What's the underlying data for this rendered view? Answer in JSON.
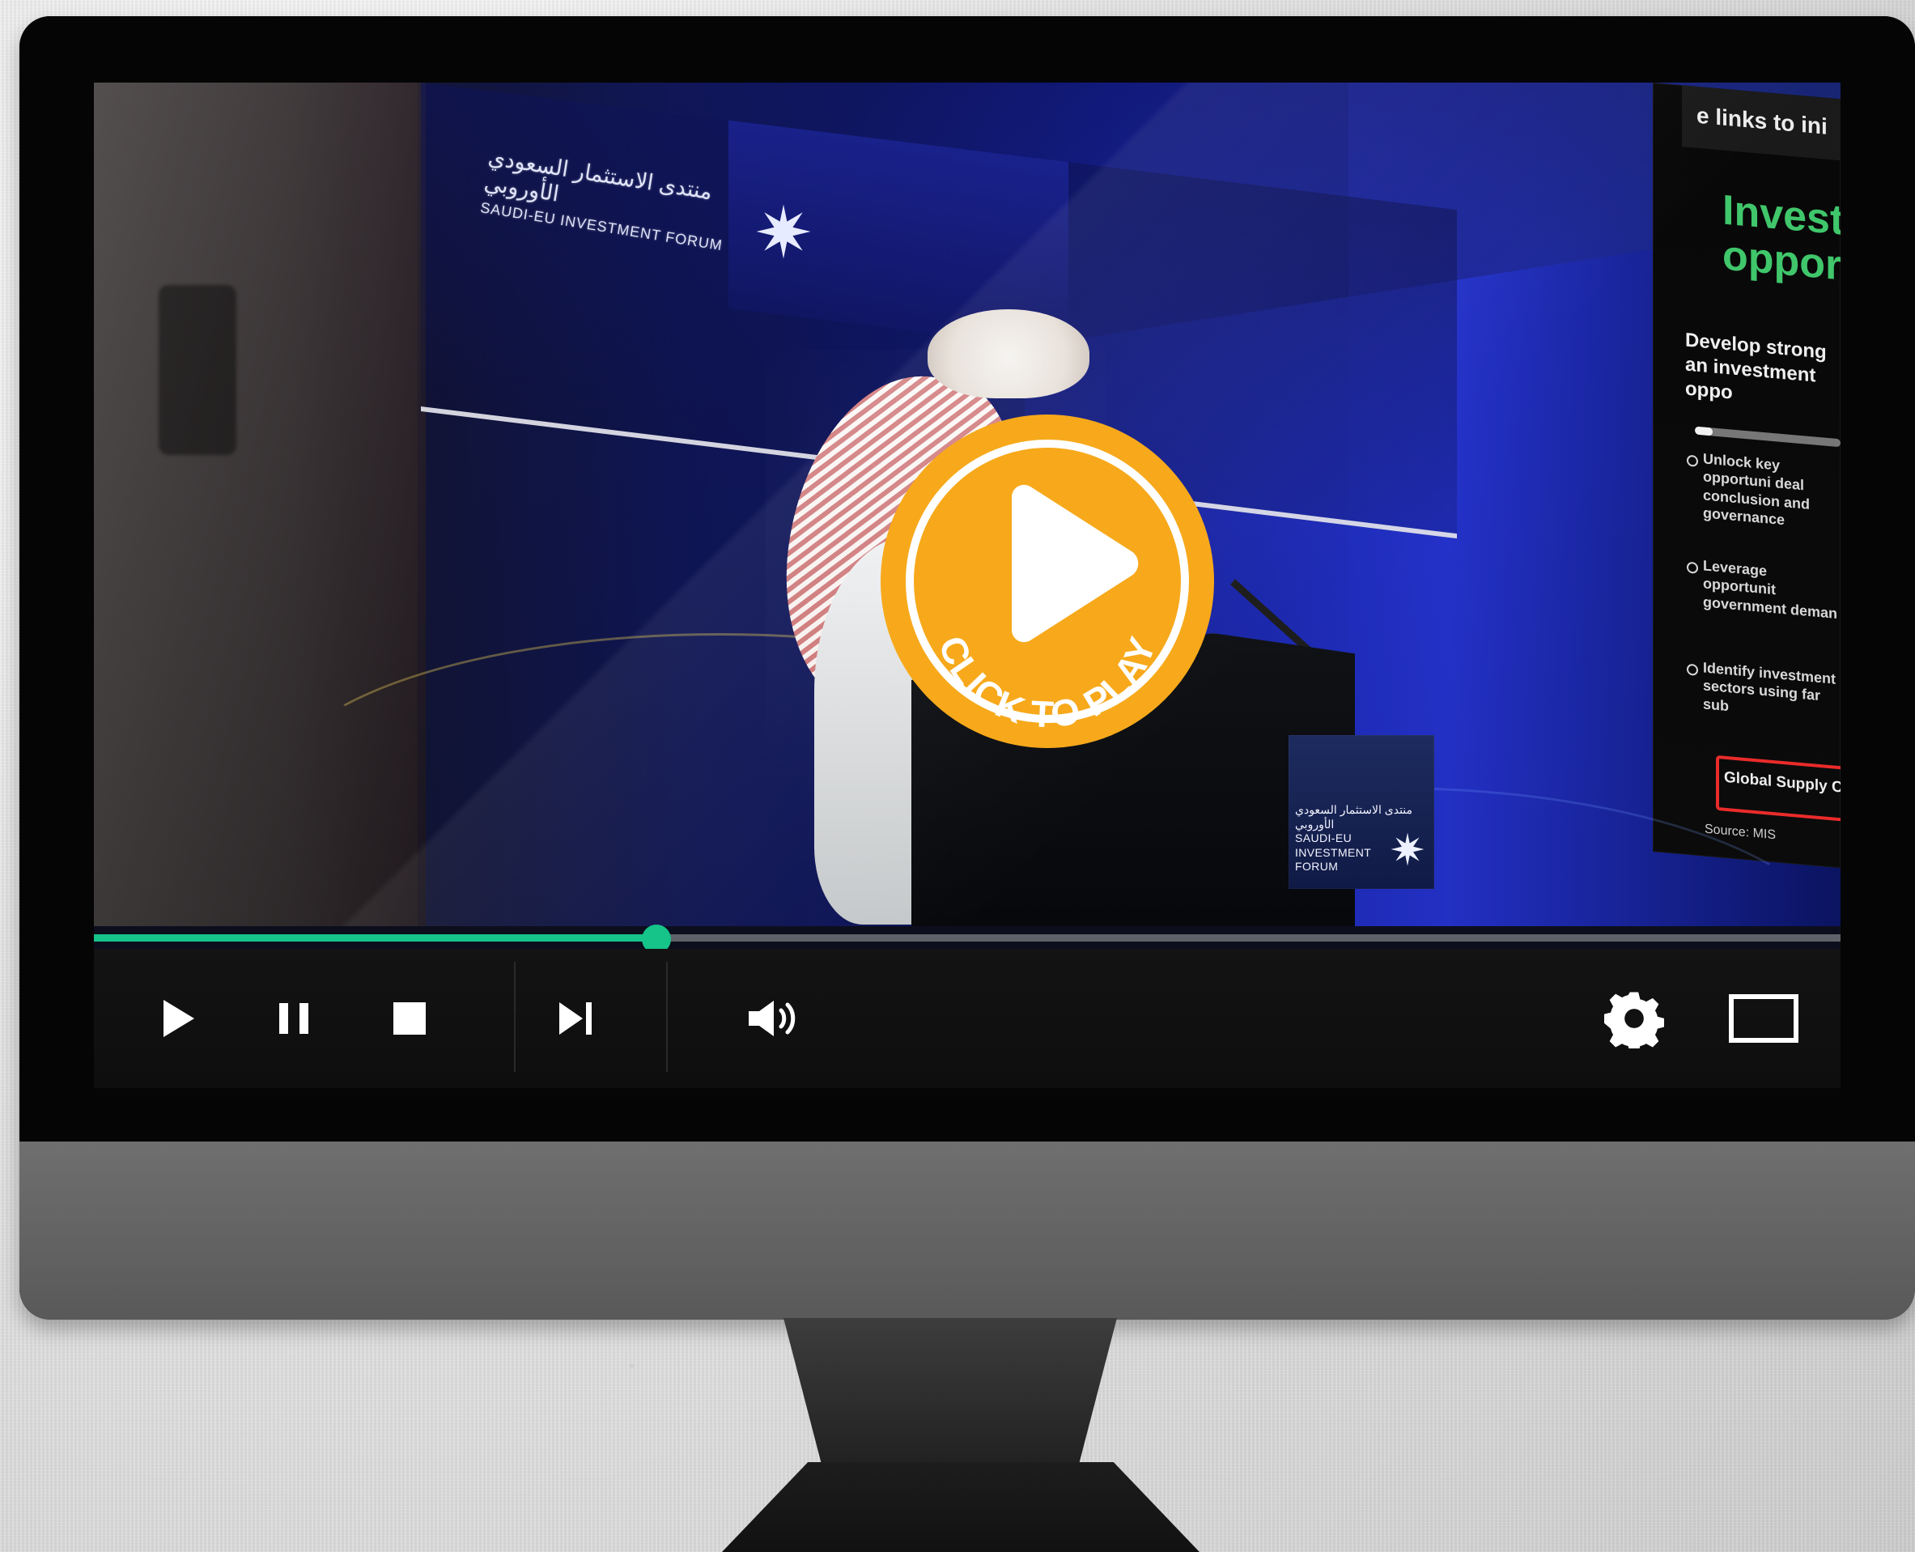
{
  "video": {
    "projection_sign_arabic": "منتدى الاستثمار السعودي الأوروبي",
    "projection_sign_english": "SAUDI-EU INVESTMENT FORUM",
    "podium_sign_arabic": "منتدى الاستثمار السعودي الأوروبي",
    "podium_sign_english": "SAUDI-EU INVESTMENT FORUM",
    "side_slide": {
      "top_text": "e links to ini",
      "heading": "Investr",
      "heading2": "opport",
      "body": "Develop strong an investment oppo",
      "bullet1": "Unlock key opportuni deal conclusion and governance",
      "bullet2": "Leverage opportunit government deman",
      "bullet3": "Identify investment sectors using far sub",
      "highlight": "Global Supply Chai",
      "source": "Source: MIS",
      "progress": 0.12
    }
  },
  "overlay": {
    "play_label": "CLICK TO PLAY",
    "play_circle_color": "#f7a91b"
  },
  "player": {
    "progress": 0.322,
    "accent_color": "#16c48a",
    "controls": {
      "play_icon": "play-icon",
      "pause_icon": "pause-icon",
      "stop_icon": "stop-icon",
      "next_icon": "next-track-icon",
      "volume_icon": "volume-icon",
      "settings_icon": "gear-icon",
      "fullscreen_icon": "fullscreen-icon"
    }
  }
}
